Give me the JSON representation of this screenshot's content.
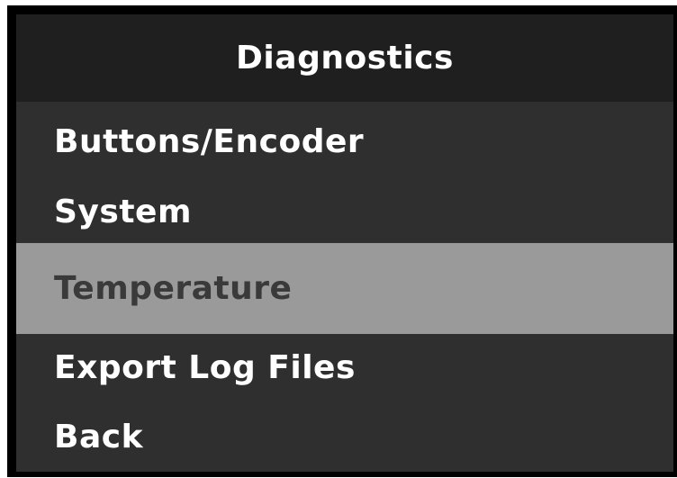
{
  "header": {
    "title": "Diagnostics"
  },
  "menu": {
    "selected_index": 2,
    "items": [
      {
        "label": "Buttons/Encoder"
      },
      {
        "label": "System"
      },
      {
        "label": "Temperature"
      },
      {
        "label": "Export Log Files"
      },
      {
        "label": "Back"
      }
    ]
  },
  "colors": {
    "background": "#2f2f2f",
    "header_background": "#1f1f1f",
    "selected_background": "#9a9a9a",
    "text": "#ffffff",
    "selected_text": "#3a3a3a",
    "bezel": "#000000"
  }
}
